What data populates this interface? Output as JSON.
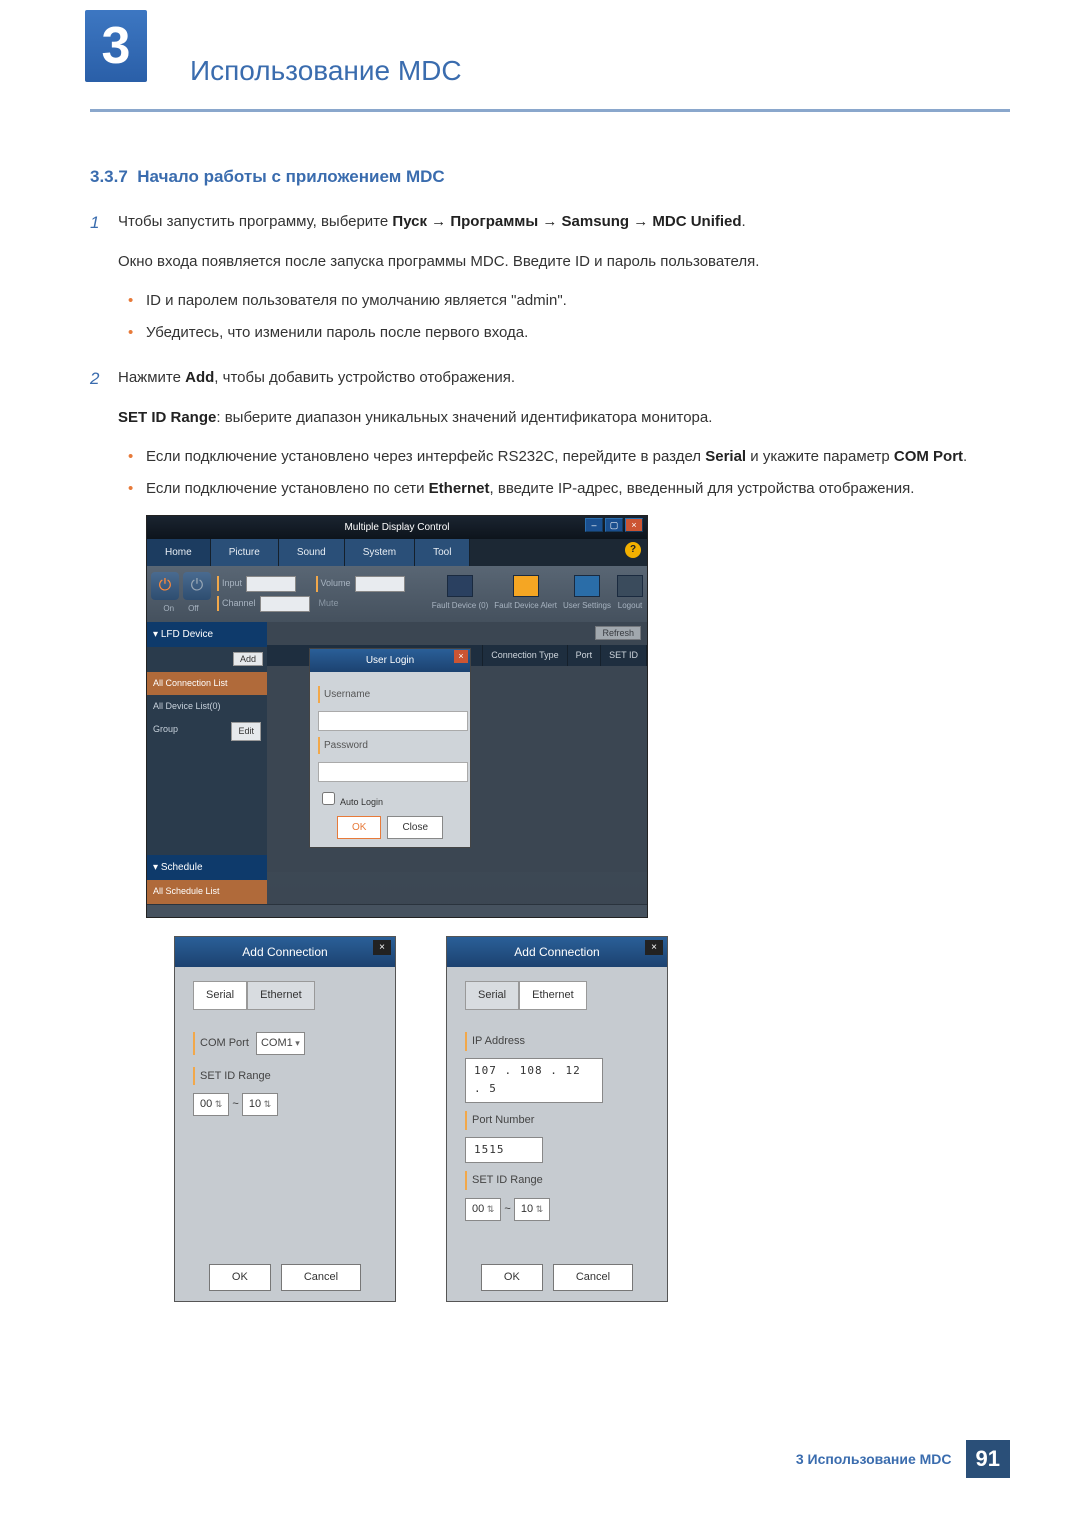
{
  "chapter": {
    "number": "3",
    "title": "Использование MDC"
  },
  "section": {
    "number": "3.3.7",
    "title": "Начало работы с приложением MDC"
  },
  "step1": {
    "n": "1",
    "line1_a": "Чтобы запустить программу, выберите ",
    "line1_b": "Пуск → Программы → Samsung → MDC Unified",
    "line2": "Окно входа появляется после запуска программы MDC. Введите ID и пароль пользователя.",
    "b1": "ID и паролем пользователя по умолчанию является \"admin\".",
    "b2": "Убедитесь, что изменили пароль после первого входа."
  },
  "step2": {
    "n": "2",
    "line1_a": "Нажмите ",
    "line1_b": "Add",
    "line1_c": ", чтобы добавить устройство отображения.",
    "line2_a": "SET ID Range",
    "line2_b": ": выберите диапазон уникальных значений идентификатора монитора.",
    "b1_a": "Если подключение установлено через интерфейс RS232C, перейдите в раздел ",
    "b1_b": "Serial",
    "b1_c": " и укажите параметр ",
    "b1_d": "COM Port",
    "b1_e": ".",
    "b2_a": "Если подключение установлено по сети ",
    "b2_b": "Ethernet",
    "b2_c": ", введите IP-адрес, введенный для устройства отображения."
  },
  "mdc": {
    "title": "Multiple Display Control",
    "tabs": {
      "home": "Home",
      "picture": "Picture",
      "sound": "Sound",
      "system": "System",
      "tool": "Tool"
    },
    "input": "Input",
    "channel": "Channel",
    "volume": "Volume",
    "mute": "Mute",
    "on": "On",
    "off": "Off",
    "fault0": "Fault Device (0)",
    "fault_alert": "Fault Device Alert",
    "user_settings": "User Settings",
    "logout": "Logout",
    "lfd": "LFD Device",
    "all_conn": "All Connection List",
    "all_dev": "All Device List(0)",
    "group": "Group",
    "edit": "Edit",
    "add": "Add",
    "schedule": "Schedule",
    "all_sched": "All Schedule List",
    "col_conn": "Connection Type",
    "col_port": "Port",
    "col_setid": "SET ID",
    "refresh": "Refresh",
    "login": {
      "title": "User Login",
      "user": "Username",
      "pass": "Password",
      "auto": "Auto Login",
      "ok": "OK",
      "close": "Close"
    }
  },
  "dlg": {
    "title": "Add Connection",
    "serial": "Serial",
    "ethernet": "Ethernet",
    "comport": "COM Port",
    "com1": "COM1",
    "setid": "SET ID Range",
    "r0": "00",
    "tilde": "~",
    "r1": "10",
    "ip": "IP Address",
    "ipval": "107 . 108 .  12 .   5",
    "portnum": "Port Number",
    "portval": "1515",
    "ok": "OK",
    "cancel": "Cancel"
  },
  "footer": {
    "text": "3 Использование MDC",
    "page": "91"
  }
}
